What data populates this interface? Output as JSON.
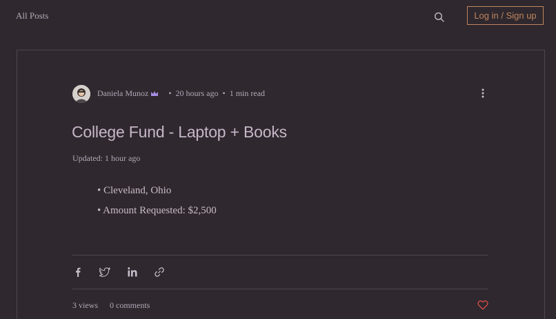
{
  "header": {
    "all_posts": "All Posts",
    "login_label": "Log in / Sign up"
  },
  "post": {
    "author": "Daniela Munoz",
    "posted_ago": "20 hours ago",
    "read_time": "1 min read",
    "title": "College Fund - Laptop + Books",
    "updated": "Updated: 1 hour ago",
    "bullets": [
      "• Cleveland, Ohio",
      "• Amount Requested: $2,500"
    ]
  },
  "share": {
    "icons": [
      "facebook-icon",
      "twitter-icon",
      "linkedin-icon",
      "link-icon"
    ]
  },
  "stats": {
    "views": "3 views",
    "comments": "0 comments"
  },
  "colors": {
    "background": "#2f282e",
    "accent": "#c0865e",
    "heart": "#e0504a",
    "text": "#b3a9b8"
  }
}
